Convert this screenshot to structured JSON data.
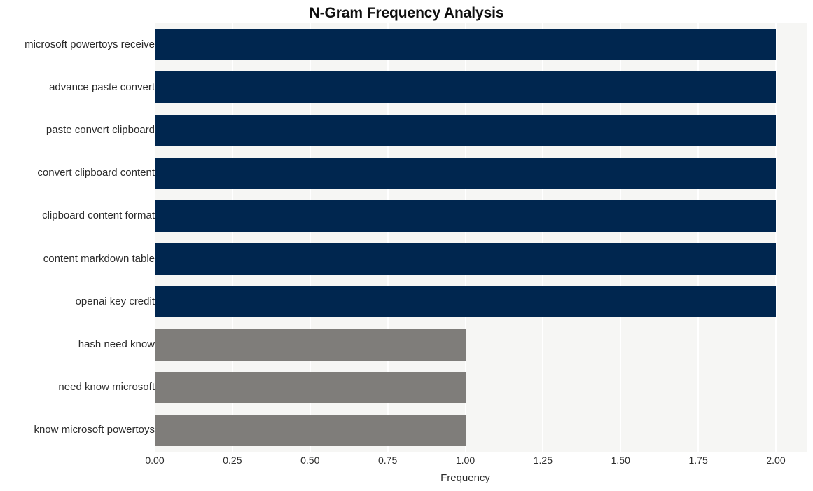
{
  "chart_data": {
    "type": "bar",
    "orientation": "horizontal",
    "title": "N-Gram Frequency Analysis",
    "xlabel": "Frequency",
    "ylabel": "",
    "categories": [
      "microsoft powertoys receive",
      "advance paste convert",
      "paste convert clipboard",
      "convert clipboard content",
      "clipboard content format",
      "content markdown table",
      "openai key credit",
      "hash need know",
      "need know microsoft",
      "know microsoft powertoys"
    ],
    "values": [
      2,
      2,
      2,
      2,
      2,
      2,
      2,
      1,
      1,
      1
    ],
    "bar_colors": [
      "#00264f",
      "#00264f",
      "#00264f",
      "#00264f",
      "#00264f",
      "#00264f",
      "#00264f",
      "#7f7d7a",
      "#7f7d7a",
      "#7f7d7a"
    ],
    "xlim": [
      0,
      2
    ],
    "xticks": [
      0,
      0.25,
      0.5,
      0.75,
      1,
      1.25,
      1.5,
      1.75,
      2
    ],
    "xtick_labels": [
      "0.00",
      "0.25",
      "0.50",
      "0.75",
      "1.00",
      "1.25",
      "1.50",
      "1.75",
      "2.00"
    ],
    "grid": true,
    "grid_color": "#ffffff",
    "plot_background": "#f6f6f4",
    "legend": null
  }
}
